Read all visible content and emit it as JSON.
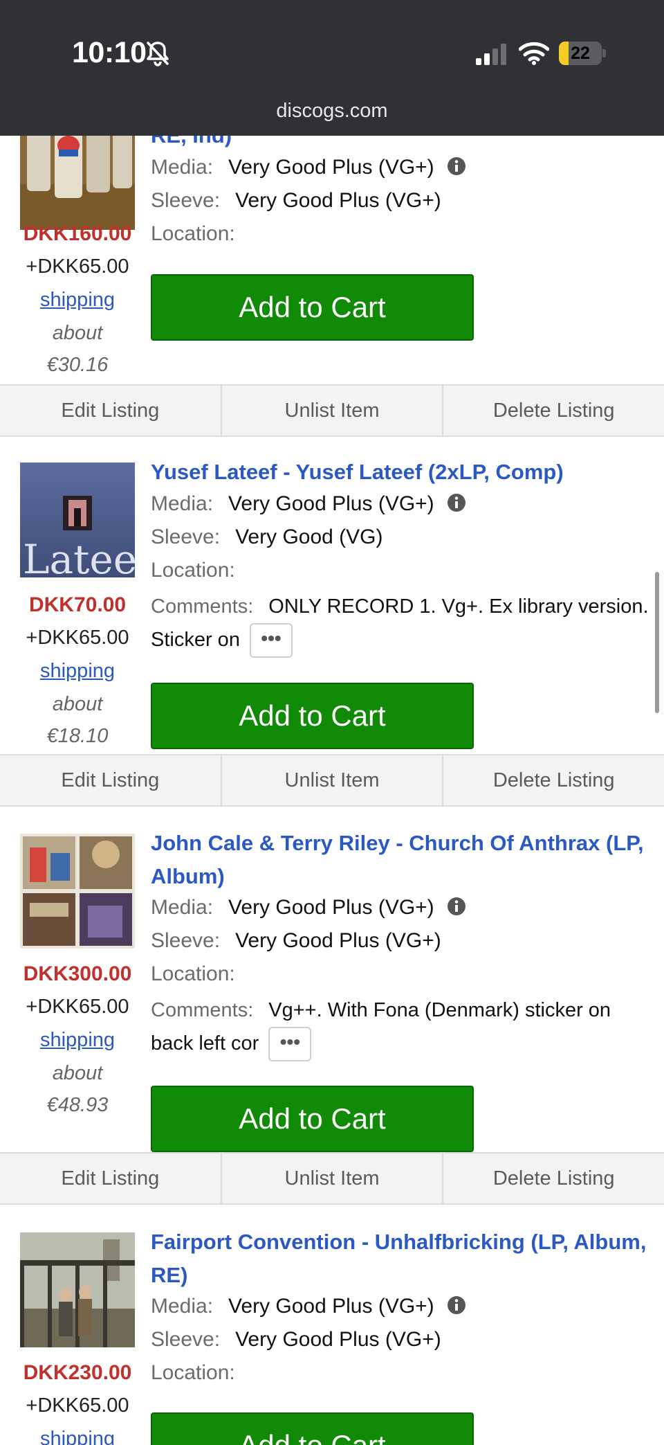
{
  "status_bar": {
    "time": "10:10",
    "battery": 22,
    "url": "discogs.com"
  },
  "listings": [
    {
      "title_tail": "RE, Ind)",
      "media_label": "Media:",
      "media_value": "Very Good Plus (VG+)",
      "sleeve_label": "Sleeve:",
      "sleeve_value": "Very Good Plus (VG+)",
      "location_label": "Location:",
      "price": "DKK160.00",
      "shipping_cost": "+DKK65.00",
      "shipping_link": "shipping",
      "about": "about",
      "converted": "€30.16",
      "cart_label": "Add to Cart"
    },
    {
      "title": "Yusef Lateef - Yusef Lateef (2xLP, Comp)",
      "media_label": "Media:",
      "media_value": "Very Good Plus (VG+)",
      "sleeve_label": "Sleeve:",
      "sleeve_value": "Very Good (VG)",
      "location_label": "Location:",
      "comments_label": "Comments:",
      "comments_value": "ONLY RECORD 1. Vg+. Ex library version. Sticker on",
      "price": "DKK70.00",
      "shipping_cost": "+DKK65.00",
      "shipping_link": "shipping",
      "about": "about",
      "converted": "€18.10",
      "cart_label": "Add to Cart",
      "cover_text": "Lateef"
    },
    {
      "title": "John Cale & Terry Riley - Church Of Anthrax (LP, Album)",
      "media_label": "Media:",
      "media_value": "Very Good Plus (VG+)",
      "sleeve_label": "Sleeve:",
      "sleeve_value": "Very Good Plus (VG+)",
      "location_label": "Location:",
      "comments_label": "Comments:",
      "comments_value": "Vg++. With Fona (Denmark) sticker on back left cor",
      "price": "DKK300.00",
      "shipping_cost": "+DKK65.00",
      "shipping_link": "shipping",
      "about": "about",
      "converted": "€48.93",
      "cart_label": "Add to Cart"
    },
    {
      "title": "Fairport Convention - Unhalfbricking (LP, Album, RE)",
      "media_label": "Media:",
      "media_value": "Very Good Plus (VG+)",
      "sleeve_label": "Sleeve:",
      "sleeve_value": "Very Good Plus (VG+)",
      "location_label": "Location:",
      "price": "DKK230.00",
      "shipping_cost": "+DKK65.00",
      "shipping_link": "shipping",
      "cart_label": "Add to Cart"
    }
  ],
  "actions": {
    "edit": "Edit Listing",
    "unlist": "Unlist Item",
    "delete": "Delete Listing"
  },
  "more_label": "•••",
  "colors": {
    "price": "#c0302c",
    "link": "#2b59c3",
    "cart": "#118a08",
    "status_bar": "#2f3134"
  }
}
